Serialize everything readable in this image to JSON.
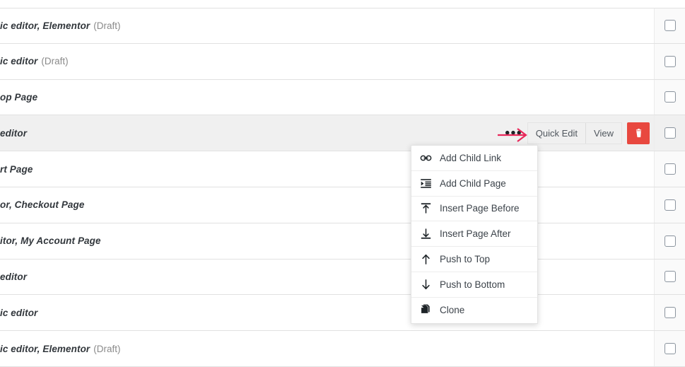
{
  "colors": {
    "accent_red": "#e8483f",
    "annotation_red": "#e8285a",
    "row_highlight": "#f0f0f0",
    "text": "#32373c",
    "muted_text": "#8a8a8a",
    "border": "#e1e1e1"
  },
  "table": {
    "rows": [
      {
        "title": "ic editor, Elementor",
        "status": " (Draft)",
        "highlighted": false,
        "checkbox_checked": false
      },
      {
        "title": "ic editor",
        "status": " (Draft)",
        "highlighted": false,
        "checkbox_checked": false
      },
      {
        "title": "op Page",
        "status": "",
        "highlighted": false,
        "checkbox_checked": false
      },
      {
        "title": "editor",
        "status": "",
        "highlighted": true,
        "checkbox_checked": false
      },
      {
        "title": "rt Page",
        "status": "",
        "highlighted": false,
        "checkbox_checked": false
      },
      {
        "title": "or, Checkout Page",
        "status": "",
        "highlighted": false,
        "checkbox_checked": false
      },
      {
        "title": "itor, My Account Page",
        "status": "",
        "highlighted": false,
        "checkbox_checked": false
      },
      {
        "title": "editor",
        "status": "",
        "highlighted": false,
        "checkbox_checked": false
      },
      {
        "title": "ic editor",
        "status": "",
        "highlighted": false,
        "checkbox_checked": false
      },
      {
        "title": "ic editor, Elementor",
        "status": " (Draft)",
        "highlighted": false,
        "checkbox_checked": false
      }
    ]
  },
  "row_actions": {
    "ellipsis_label": "•••",
    "quick_edit_label": "Quick Edit",
    "view_label": "View",
    "trash_icon": "trash-icon"
  },
  "context_menu": {
    "items": [
      {
        "label": "Add Child Link",
        "icon": "link-icon"
      },
      {
        "label": "Add Child Page",
        "icon": "indent-page-icon"
      },
      {
        "label": "Insert Page Before",
        "icon": "arrow-up-to-bar-icon"
      },
      {
        "label": "Insert Page After",
        "icon": "arrow-down-to-bar-icon"
      },
      {
        "label": "Push to Top",
        "icon": "arrow-up-icon"
      },
      {
        "label": "Push to Bottom",
        "icon": "arrow-down-icon"
      },
      {
        "label": "Clone",
        "icon": "copy-icon"
      }
    ]
  },
  "annotation": {
    "arrow": "right-arrow-annotation"
  }
}
